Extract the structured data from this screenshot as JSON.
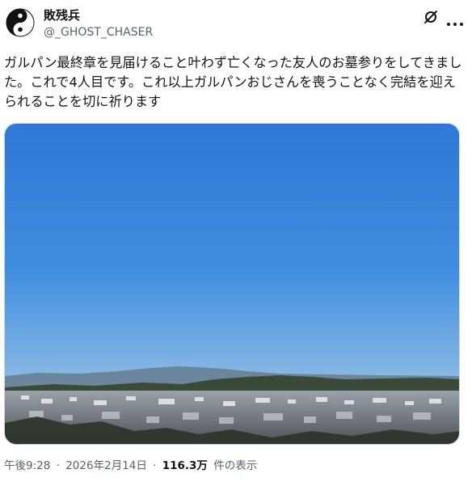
{
  "post": {
    "author": {
      "display_name": "敗残兵",
      "handle": "@_GHOST_CHASER",
      "avatar_icon": "yin-yang-icon"
    },
    "actions": {
      "grok_icon": "grok-icon",
      "more_icon": "more-options-icon"
    },
    "text": "ガルパン最終章を見届けること叶わず亡くなった友人のお墓参りをしてきました。これで4人目です。これ以上ガルパンおじさんを喪うことなく完結を迎えられることを切に祈ります",
    "media": {
      "kind": "landscape photo",
      "colors": {
        "sky_top": "#2f78d6",
        "sky_bottom": "#aacbe6",
        "mountain": "#5d7288",
        "hill": "#34422f",
        "town": "#8a8f98"
      }
    },
    "meta": {
      "time": "午後9:28",
      "date": "2026年2月14日",
      "separator": "·",
      "views_count": "116.3万",
      "views_label": "件の表示"
    }
  }
}
